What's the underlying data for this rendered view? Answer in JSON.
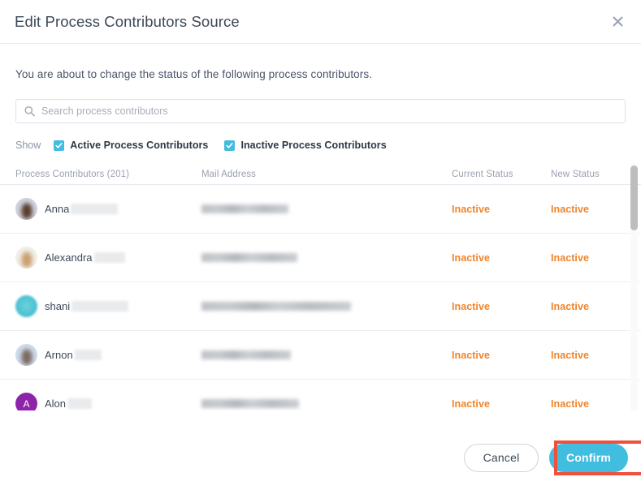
{
  "dialog": {
    "title": "Edit Process Contributors Source",
    "close_icon": "close-icon",
    "intro": "You are about to change the status of the following process contributors."
  },
  "search": {
    "placeholder": "Search process contributors",
    "value": "",
    "icon": "search-icon"
  },
  "filters": {
    "label": "Show",
    "options": [
      {
        "label": "Active Process Contributors",
        "checked": true
      },
      {
        "label": "Inactive Process Contributors",
        "checked": true
      }
    ]
  },
  "table": {
    "headers": {
      "name": "Process Contributors (201)",
      "mail": "Mail Address",
      "current": "Current Status",
      "new": "New Status"
    },
    "count": 201,
    "rows": [
      {
        "first_name": "Anna",
        "last_name_redacted_width": 58,
        "mail_redacted_width": 107,
        "avatar_type": "photo",
        "avatar_color": "#cfd3dd",
        "avatar_fg": "#5a3b2e",
        "avatar_initial": "",
        "current_status": "Inactive",
        "new_status": "Inactive"
      },
      {
        "first_name": "Alexandra",
        "last_name_redacted_width": 38,
        "mail_redacted_width": 118,
        "avatar_type": "photo",
        "avatar_color": "#f2efe9",
        "avatar_fg": "#c9a070",
        "avatar_initial": "",
        "current_status": "Inactive",
        "new_status": "Inactive"
      },
      {
        "first_name": "shani",
        "last_name_redacted_width": 70,
        "mail_redacted_width": 184,
        "avatar_type": "solid",
        "avatar_color": "#4fc3d3",
        "avatar_fg": "#6fd0dd",
        "avatar_initial": "",
        "current_status": "Inactive",
        "new_status": "Inactive"
      },
      {
        "first_name": "Arnon",
        "last_name_redacted_width": 33,
        "mail_redacted_width": 110,
        "avatar_type": "photo",
        "avatar_color": "#cfdcea",
        "avatar_fg": "#7a6a62",
        "avatar_initial": "",
        "current_status": "Inactive",
        "new_status": "Inactive"
      },
      {
        "first_name": "Alon",
        "last_name_redacted_width": 30,
        "mail_redacted_width": 120,
        "avatar_type": "initial",
        "avatar_color": "#8e24aa",
        "avatar_fg": "#ffffff",
        "avatar_initial": "A",
        "current_status": "Inactive",
        "new_status": "Inactive"
      }
    ]
  },
  "footer": {
    "cancel_label": "Cancel",
    "confirm_label": "Confirm"
  },
  "colors": {
    "accent": "#41bde0",
    "status_inactive": "#f1842a",
    "highlight": "#f0513c",
    "title_text": "#3c4858"
  }
}
